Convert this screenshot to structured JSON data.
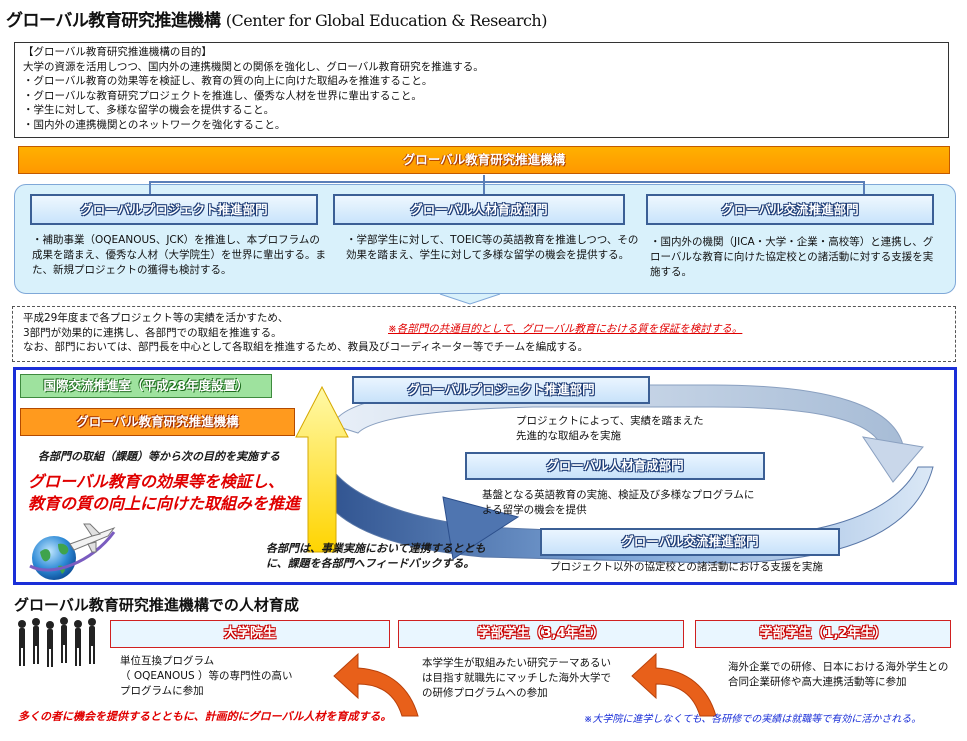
{
  "title": {
    "ja": "グローバル教育研究推進機構",
    "en": "(Center for Global Education & Research)"
  },
  "purpose": {
    "heading": "【グローバル教育研究推進機構の目的】",
    "lines": [
      "大学の資源を活用しつつ、国内外の連携機関との関係を強化し、グローバル教育研究を推進する。",
      "・グローバル教育の効果等を検証し、教育の質の向上に向けた取組みを推進すること。",
      "・グローバルな教育研究プロジェクトを推進し、優秀な人材を世界に輩出すること。",
      "・学生に対して、多様な留学の機会を提供すること。",
      "・国内外の連携機関とのネットワークを強化すること。"
    ]
  },
  "org_bar": "グローバル教育研究推進機構",
  "departments": [
    {
      "name": "グローバルプロジェクト推進部門",
      "text": "・補助事業（OQEANOUS、JCK）を推進し、本プロフラムの成果を踏まえ、優秀な人材（大学院生）を世界に輩出する。また、新規プロジェクトの獲得も検討する。"
    },
    {
      "name": "グローバル人材育成部門",
      "text": "・学部学生に対して、TOEIC等の英語教育を推進しつつ、その効果を踏まえ、学生に対して多様な留学の機会を提供する。"
    },
    {
      "name": "グローバル交流推進部門",
      "text": "・国内外の機関（JICA・大学・企業・高校等）と連携し、グローバルな教育に向けた協定校との諸活動に対する支援を実施する。"
    }
  ],
  "coordination": {
    "lines": [
      "平成29年度まで各プロジェクト等の実績を活かすため、",
      "3部門が効果的に連携し、各部門での取組を推進する。",
      "なお、部門においては、部門長を中心として各取組を推進するため、教員及びコーディネーター等でチームを編成する。"
    ],
    "note": "※各部門の共通目的として、グローバル教育における質を保証を検討する。"
  },
  "cycle": {
    "international_office": "国際交流推進室（平成28年度設置）",
    "org_label": "グローバル教育研究推進機構",
    "next_goal": "各部門の取組（課題）等から次の目的を実施する",
    "main_line1": "グローバル教育の効果等を検証し、",
    "main_line2": "教育の質の向上に向けた取組みを推進",
    "feedback_line1": "各部門は、事業実施において連携するととも",
    "feedback_line2": "に、課題を各部門へフィードバックする。",
    "depts": [
      {
        "name": "グローバルプロジェクト推進部門",
        "desc": "プロジェクトによって、実績を踏まえた\n先進的な取組みを実施"
      },
      {
        "name": "グローバル人材育成部門",
        "desc": "基盤となる英語教育の実施、検証及び多様なプログラムによる留学の機会を提供"
      },
      {
        "name": "グローバル交流推進部門",
        "desc": "プロジェクト以外の協定校との諸活動における支援を実施"
      }
    ]
  },
  "hr": {
    "title": "グローバル教育研究推進機構での人材育成",
    "groups": [
      {
        "name": "大学院生",
        "desc": "単位互換プログラム\n（ OQEANOUS ）等の専門性の高い\nプログラムに参加"
      },
      {
        "name": "学部学生（3,4年生）",
        "desc": "本学学生が取組みたい研究テーマあるいは目指す就職先にマッチした海外大学での研修プログラムへの参加"
      },
      {
        "name": "学部学生（1,2年生）",
        "desc": "海外企業での研修、日本における海外学生との合同企業研修や高大連携活動等に参加"
      }
    ],
    "footer_left": "多くの者に機会を提供するとともに、計画的にグローバル人材を育成する。",
    "footer_right": "※大学院に進学しなくても、各研修での実績は就職等で有効に活かされる。"
  },
  "colors": {
    "orange": "#ff9800",
    "blue_border": "#1a2fd8",
    "dept_border": "#3b5f95",
    "red": "#e00000"
  }
}
